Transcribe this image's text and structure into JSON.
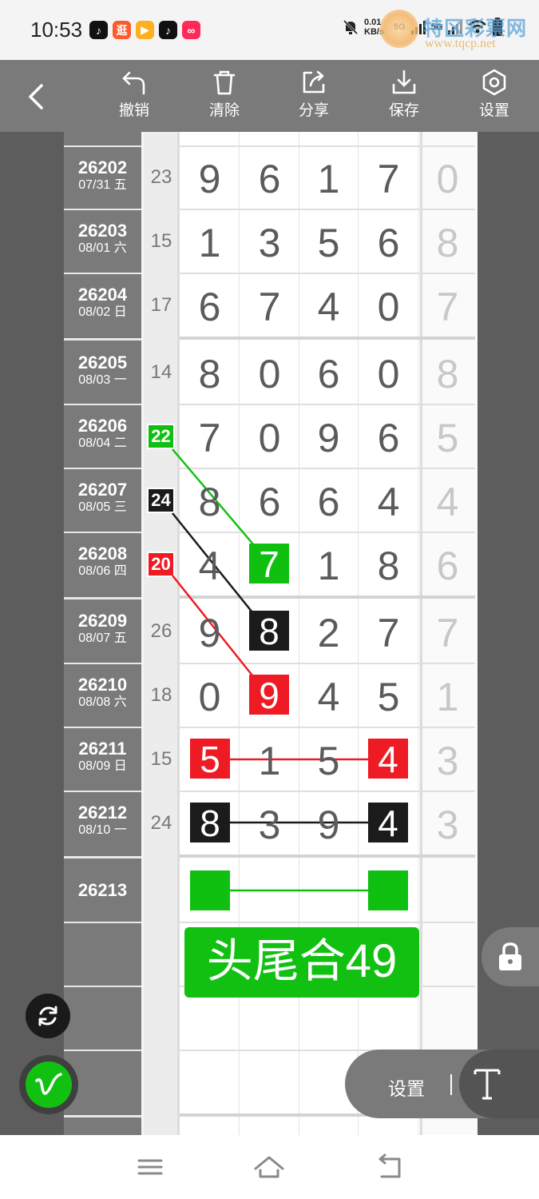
{
  "status_bar": {
    "time": "10:53",
    "apps": [
      {
        "glyph": "♪",
        "color": "#111111"
      },
      {
        "glyph": "逛",
        "color": "#ff5a2b"
      },
      {
        "glyph": "▶",
        "color": "#ffb020"
      },
      {
        "glyph": "♪",
        "color": "#111111"
      },
      {
        "glyph": "∞",
        "color": "#ff2a5a"
      }
    ],
    "net_speed": "0.01",
    "net_unit": "KB/s",
    "signal": "5G",
    "signal2": "5G"
  },
  "watermark": {
    "title": "特区彩票网",
    "url": "www.tqcp.net"
  },
  "toolbar": {
    "undo_label": "撤销",
    "clear_label": "清除",
    "share_label": "分享",
    "save_label": "保存",
    "settings_label": "设置"
  },
  "rows": [
    {
      "no": "26202",
      "date": "07/31 五",
      "sum": "23",
      "digits": [
        "9",
        "6",
        "1",
        "7"
      ],
      "tail": "0"
    },
    {
      "no": "26203",
      "date": "08/01 六",
      "sum": "15",
      "digits": [
        "1",
        "3",
        "5",
        "6"
      ],
      "tail": "8"
    },
    {
      "no": "26204",
      "date": "08/02 日",
      "sum": "17",
      "digits": [
        "6",
        "7",
        "4",
        "0"
      ],
      "tail": "7"
    },
    {
      "no": "26205",
      "date": "08/03 一",
      "sum": "14",
      "digits": [
        "8",
        "0",
        "6",
        "0"
      ],
      "tail": "8"
    },
    {
      "no": "26206",
      "date": "08/04 二",
      "sum": "22",
      "digits": [
        "7",
        "0",
        "9",
        "6"
      ],
      "tail": "5"
    },
    {
      "no": "26207",
      "date": "08/05 三",
      "sum": "24",
      "digits": [
        "8",
        "6",
        "6",
        "4"
      ],
      "tail": "4"
    },
    {
      "no": "26208",
      "date": "08/06 四",
      "sum": "20",
      "digits": [
        "4",
        "7",
        "1",
        "8"
      ],
      "tail": "6"
    },
    {
      "no": "26209",
      "date": "08/07 五",
      "sum": "26",
      "digits": [
        "9",
        "8",
        "2",
        "7"
      ],
      "tail": "7"
    },
    {
      "no": "26210",
      "date": "08/08 六",
      "sum": "18",
      "digits": [
        "0",
        "9",
        "4",
        "5"
      ],
      "tail": "1"
    },
    {
      "no": "26211",
      "date": "08/09 日",
      "sum": "15",
      "digits": [
        "5",
        "1",
        "5",
        "4"
      ],
      "tail": "3"
    },
    {
      "no": "26212",
      "date": "08/10 一",
      "sum": "24",
      "digits": [
        "8",
        "3",
        "9",
        "4"
      ],
      "tail": "3"
    },
    {
      "no": "26213",
      "date": "",
      "sum": "",
      "digits": [
        "",
        "",
        "",
        ""
      ],
      "tail": ""
    }
  ],
  "banner_text": "头尾合49",
  "floating": {
    "settings_label": "设置",
    "text_tool_glyph": "T"
  },
  "colors": {
    "green": "#10c010",
    "black": "#1b1b1b",
    "red": "#ee1b24"
  }
}
